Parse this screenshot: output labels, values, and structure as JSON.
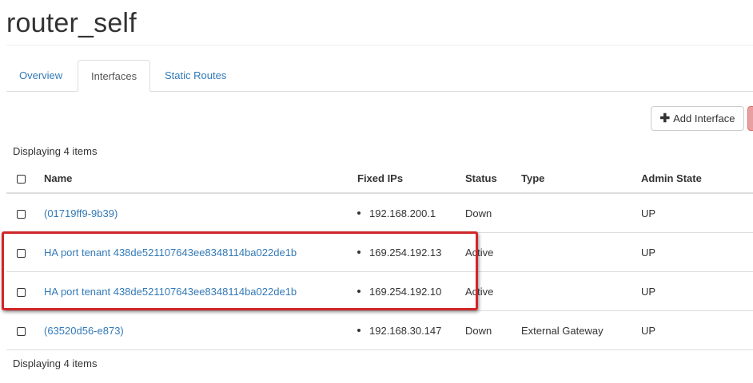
{
  "page": {
    "title": "router_self"
  },
  "tabs": [
    {
      "label": "Overview",
      "active": false
    },
    {
      "label": "Interfaces",
      "active": true
    },
    {
      "label": "Static Routes",
      "active": false
    }
  ],
  "toolbar": {
    "add_label": "Add Interface",
    "add_icon": "plus-icon"
  },
  "table": {
    "count_top": "Displaying 4 items",
    "count_bottom": "Displaying 4 items",
    "columns": [
      "Name",
      "Fixed IPs",
      "Status",
      "Type",
      "Admin State"
    ],
    "rows": [
      {
        "name": "(01719ff9-9b39)",
        "fixed_ip": "192.168.200.1",
        "status": "Down",
        "type": "",
        "admin_state": "UP"
      },
      {
        "name": "HA port tenant 438de521107643ee8348114ba022de1b",
        "fixed_ip": "169.254.192.13",
        "status": "Active",
        "type": "",
        "admin_state": "UP"
      },
      {
        "name": "HA port tenant 438de521107643ee8348114ba022de1b",
        "fixed_ip": "169.254.192.10",
        "status": "Active",
        "type": "",
        "admin_state": "UP"
      },
      {
        "name": "(63520d56-e873)",
        "fixed_ip": "192.168.30.147",
        "status": "Down",
        "type": "External Gateway",
        "admin_state": "UP"
      }
    ]
  },
  "colors": {
    "link": "#337ab7",
    "highlight": "#d0262a",
    "danger": "#d9534f"
  }
}
